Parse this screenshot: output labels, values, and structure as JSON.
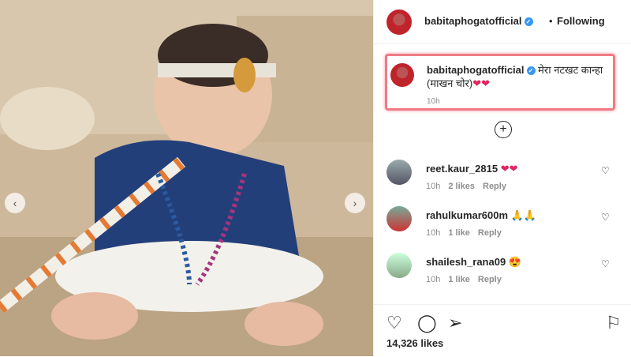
{
  "post": {
    "username": "babitaphogatofficial",
    "separator": "•",
    "follow_label": "Following",
    "caption_text": "मेरा नटखट कान्हा (माखन चोर)",
    "caption_emoji": "❤❤",
    "caption_time": "10h",
    "verified_glyph": "✓"
  },
  "comments": [
    {
      "user": "reet.kaur_2815",
      "text": "❤❤",
      "time": "10h",
      "likes": "2 likes",
      "reply": "Reply"
    },
    {
      "user": "rahulkumar600m",
      "text": "🙏🙏",
      "time": "10h",
      "likes": "1 like",
      "reply": "Reply"
    },
    {
      "user": "shailesh_rana09",
      "text": "😍",
      "time": "10h",
      "likes": "1 like",
      "reply": "Reply"
    }
  ],
  "actions": {
    "likes_count": "14,326 likes",
    "icons": [
      "heart-icon",
      "comment-icon",
      "share-icon",
      "bookmark-icon"
    ]
  },
  "colors": {
    "verified": "#3897f0",
    "highlight": "#f07a86",
    "hearts": "#e0245e"
  }
}
